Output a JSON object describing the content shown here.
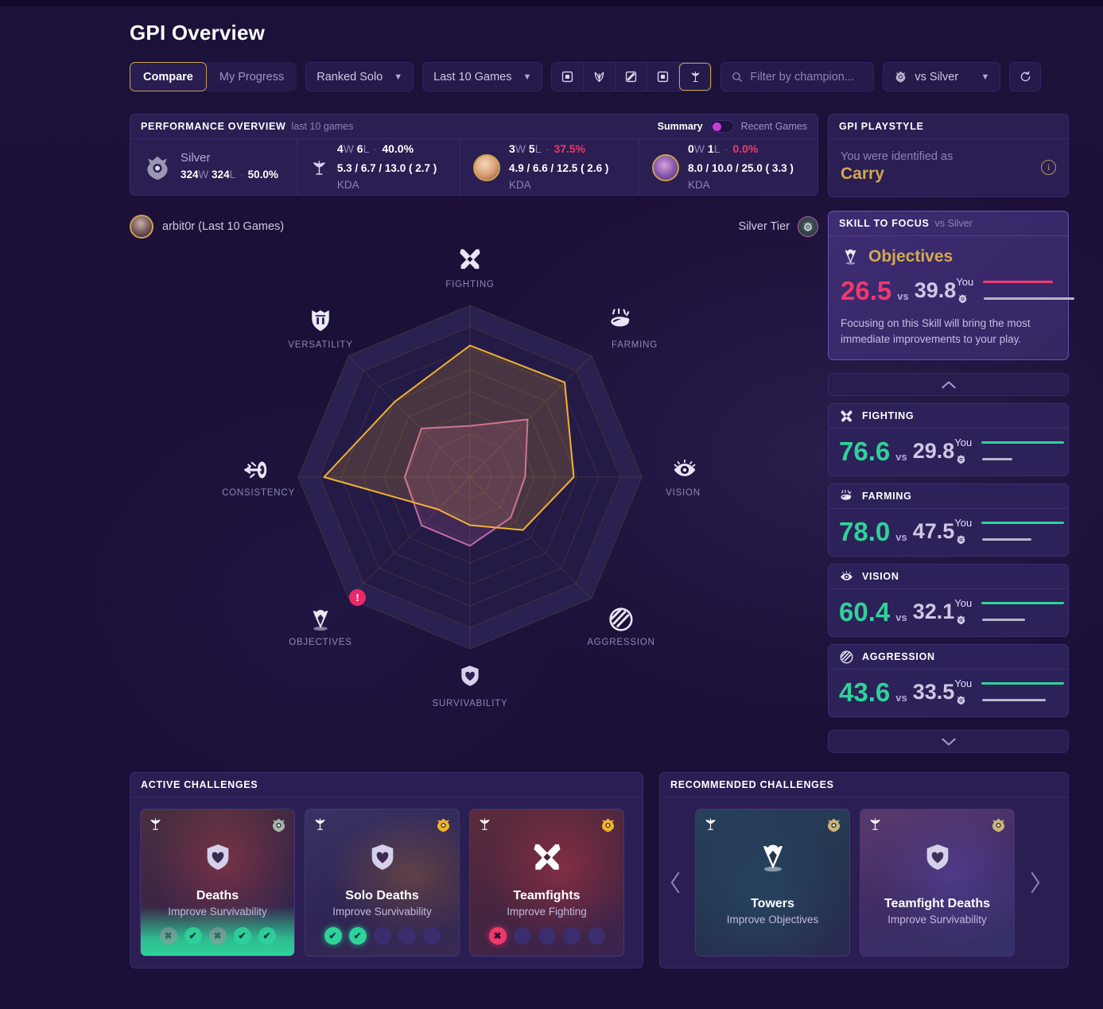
{
  "header": {
    "title": "GPI Overview",
    "segmented": [
      {
        "label": "Compare",
        "active": true
      },
      {
        "label": "My Progress",
        "active": false
      }
    ],
    "queue_filter": "Ranked Solo",
    "range_filter": "Last 10 Games",
    "role_icons": [
      "top-lane-icon",
      "jungle-lane-icon",
      "mid-lane-icon",
      "bot-lane-icon",
      "support-lane-icon"
    ],
    "selected_role_index": 4,
    "search_placeholder": "Filter by champion...",
    "compare_target": "vs Silver",
    "refresh_label": "refresh-icon"
  },
  "performance": {
    "title": "PERFORMANCE OVERVIEW",
    "subtitle": "last 10 games",
    "toggle": {
      "left": "Summary",
      "right": "Recent Games",
      "active": "left"
    },
    "cells": [
      {
        "kind": "rank",
        "name": "Silver",
        "wins": "324",
        "losses": "324",
        "winrate": "50.0%",
        "winrate_state": "neutral"
      },
      {
        "kind": "role",
        "icon": "support-lane-icon",
        "wins": "4",
        "losses": "6",
        "winrate": "40.0%",
        "winrate_state": "neutral",
        "kda": "5.3 / 6.7 / 13.0 ( 2.7 )",
        "kda_label": "KDA"
      },
      {
        "kind": "champion",
        "avatar": "champion-a",
        "wins": "3",
        "losses": "5",
        "winrate": "37.5%",
        "winrate_state": "bad",
        "kda": "4.9 / 6.6 / 12.5 ( 2.6 )",
        "kda_label": "KDA"
      },
      {
        "kind": "champion",
        "avatar": "champion-b",
        "wins": "0",
        "losses": "1",
        "winrate": "0.0%",
        "winrate_state": "bad",
        "kda": "8.0 / 10.0 / 25.0 ( 3.3 )",
        "kda_label": "KDA"
      }
    ],
    "w_suffix": "W",
    "l_suffix": "L"
  },
  "player": {
    "name": "arbit0r (Last 10 Games)",
    "tier_label": "Silver Tier"
  },
  "chart_data": {
    "type": "radar",
    "title": "GPI Overview",
    "categories": [
      "FIGHTING",
      "FARMING",
      "VISION",
      "AGGRESSION",
      "SURVIVABILITY",
      "OBJECTIVES",
      "CONSISTENCY",
      "VERSATILITY"
    ],
    "range": [
      0,
      100
    ],
    "rings": 8,
    "legend_position": "none",
    "series": [
      {
        "name": "You",
        "color": "#f2b233",
        "values": [
          76.6,
          78.0,
          60.4,
          43.6,
          28.0,
          26.5,
          85.0,
          62.0
        ]
      },
      {
        "name": "Silver",
        "color": "#c46aa8",
        "values": [
          29.8,
          47.5,
          32.1,
          33.5,
          40.0,
          39.8,
          38.0,
          40.0
        ]
      }
    ],
    "alert_axis": "OBJECTIVES",
    "alert_symbol": "!"
  },
  "playstyle": {
    "title": "GPI PLAYSTYLE",
    "label": "You were identified as",
    "value": "Carry",
    "info_icon": "info-icon"
  },
  "focus": {
    "title": "SKILL TO FOCUS",
    "subtitle": "vs Silver",
    "skill": "Objectives",
    "skill_icon": "objectives-icon",
    "you_score": "26.5",
    "vs": "vs",
    "opponent_score": "39.8",
    "you_label": "You",
    "opponent_icon": "silver-rank-icon",
    "you_bar_pct": 66,
    "opp_bar_pct": 100,
    "you_bar_color": "#ef3d70",
    "opp_bar_color": "#b9b5cc",
    "note": "Focusing on this Skill will bring the most immediate improvements to your play."
  },
  "collapse": {
    "up_icon": "chevron-up-icon",
    "down_icon": "chevron-down-icon"
  },
  "skills": [
    {
      "name": "FIGHTING",
      "icon": "fighting-icon",
      "you": "76.6",
      "vs": "vs",
      "opponent": "29.8",
      "you_label": "You",
      "you_bar_pct": 100,
      "opp_bar_pct": 38
    },
    {
      "name": "FARMING",
      "icon": "farming-icon",
      "you": "78.0",
      "vs": "vs",
      "opponent": "47.5",
      "you_label": "You",
      "you_bar_pct": 100,
      "opp_bar_pct": 60
    },
    {
      "name": "VISION",
      "icon": "vision-icon",
      "you": "60.4",
      "vs": "vs",
      "opponent": "32.1",
      "you_label": "You",
      "you_bar_pct": 100,
      "opp_bar_pct": 53
    },
    {
      "name": "AGGRESSION",
      "icon": "aggression-icon",
      "you": "43.6",
      "vs": "vs",
      "opponent": "33.5",
      "you_label": "You",
      "you_bar_pct": 100,
      "opp_bar_pct": 77
    }
  ],
  "active_challenges": {
    "title": "ACTIVE CHALLENGES",
    "cards": [
      {
        "name": "Deaths",
        "sub": "Improve Survivability",
        "icon": "survivability-shield-icon",
        "role_icon": "support-lane-icon",
        "rank_icon": "silver-rank-icon",
        "rank_tone": "silver",
        "progress": [
          "fail",
          "ok",
          "fail",
          "ok",
          "ok"
        ],
        "highlight": true,
        "art": "deaths"
      },
      {
        "name": "Solo Deaths",
        "sub": "Improve Survivability",
        "icon": "survivability-shield-icon",
        "role_icon": "support-lane-icon",
        "rank_icon": "gold-rank-icon",
        "rank_tone": "gold",
        "progress": [
          "ok",
          "ok",
          "empty",
          "empty",
          "empty"
        ],
        "highlight": false,
        "art": "solodeaths"
      },
      {
        "name": "Teamfights",
        "sub": "Improve Fighting",
        "icon": "fighting-icon",
        "role_icon": "support-lane-icon",
        "rank_icon": "gold-rank-icon",
        "rank_tone": "gold",
        "progress": [
          "failbright",
          "empty",
          "empty",
          "empty",
          "empty"
        ],
        "highlight": false,
        "art": "teamfights"
      }
    ]
  },
  "recommended_challenges": {
    "title": "RECOMMENDED CHALLENGES",
    "prev_icon": "chevron-left-icon",
    "next_icon": "chevron-right-icon",
    "cards": [
      {
        "name": "Towers",
        "sub": "Improve Objectives",
        "icon": "objectives-icon",
        "role_icon": "support-lane-icon",
        "rank_icon": "silver-rank-icon",
        "art": "towers"
      },
      {
        "name": "Teamfight Deaths",
        "sub": "Improve Survivability",
        "icon": "survivability-shield-icon",
        "role_icon": "support-lane-icon",
        "rank_icon": "silver-rank-icon",
        "art": "tfdeaths"
      }
    ]
  }
}
